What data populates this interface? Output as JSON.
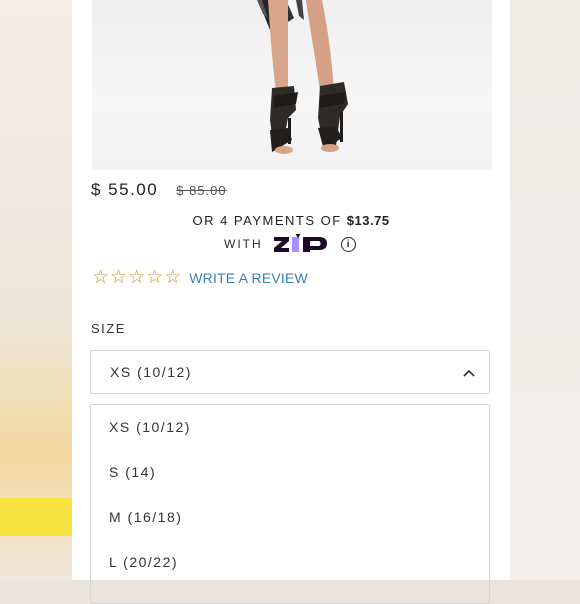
{
  "product": {
    "sale_price": "$ 55.00",
    "original_price": "$ 85.00"
  },
  "installments": {
    "prefix": "OR 4 PAYMENTS OF",
    "amount": "$13.75",
    "with_label": "WITH",
    "provider_logo_text": "zip",
    "info_icon_glyph": "i"
  },
  "reviews": {
    "star_icon": "star-outline-icon",
    "star_count": 5,
    "stars": [
      "☆",
      "☆",
      "☆",
      "☆",
      "☆"
    ],
    "write_review_label": "WRITE A REVIEW"
  },
  "size": {
    "label": "SIZE",
    "selected": "XS (10/12)",
    "options": [
      "XS (10/12)",
      "S (14)",
      "M (16/18)",
      "L (20/22)"
    ],
    "highlighted_option": "M (16/18)"
  },
  "colors": {
    "star": "#d98e2a",
    "link": "#3a7bbf",
    "highlight": "#f6e33a",
    "zip_purple": "#aa8fff"
  }
}
